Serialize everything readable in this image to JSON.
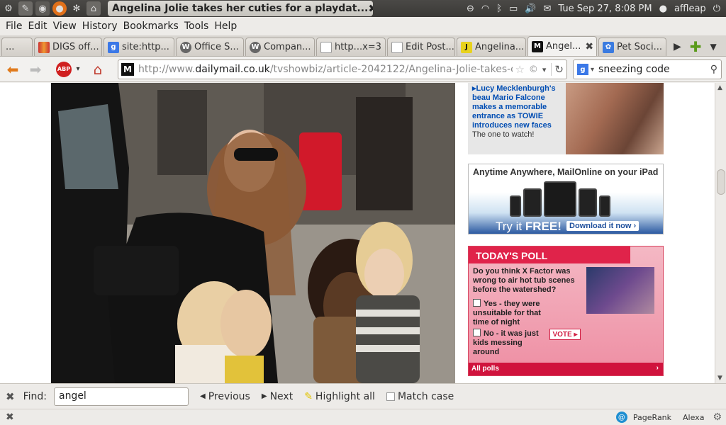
{
  "window": {
    "title": "Angelina Jolie takes her cuties for a playdat..."
  },
  "tray": {
    "datetime": "Tue Sep 27,  8:08 PM",
    "user": "affleap"
  },
  "menu": [
    "File",
    "Edit",
    "View",
    "History",
    "Bookmarks",
    "Tools",
    "Help"
  ],
  "tabs": [
    {
      "label": "...",
      "fav": ""
    },
    {
      "label": "DIGS off...",
      "fav": "digs"
    },
    {
      "label": "site:http...",
      "fav": "google"
    },
    {
      "label": "Office S...",
      "fav": "wp"
    },
    {
      "label": "Compan...",
      "fav": "wp"
    },
    {
      "label": "http...x=3",
      "fav": "doc"
    },
    {
      "label": "Edit Post...",
      "fav": "doc"
    },
    {
      "label": "Angelina...",
      "fav": "j"
    },
    {
      "label": "Angel...",
      "fav": "dm",
      "active": true
    },
    {
      "label": "Pet Soci...",
      "fav": "paw"
    }
  ],
  "nav": {
    "url_prefix": "http://www.",
    "url_domain": "dailymail.co.uk",
    "url_path": "/tvshowbiz/article-2042122/Angelina-Jolie-takes-cutie",
    "search_value": "sneezing code"
  },
  "promo": {
    "headline": "Lucy Mecklenburgh's beau Mario Falcone makes a memorable entrance as TOWIE introduces new faces",
    "sub": "The one to watch!"
  },
  "ipad": {
    "title": "Anytime Anywhere, MailOnline on your iPad",
    "try": "Try it ",
    "free": "FREE!",
    "download": "Download it now"
  },
  "poll": {
    "header": "TODAY'S POLL",
    "question": "Do you think X Factor was wrong to air hot tub scenes before the watershed?",
    "option1": "Yes - they were unsuitable for that time of night",
    "option2": "No - it was just kids messing around",
    "vote": "VOTE",
    "all": "All polls"
  },
  "find": {
    "label": "Find:",
    "value": "angel",
    "previous": "Previous",
    "next": "Next",
    "highlight": "Highlight all",
    "match_case": "Match case"
  },
  "status": {
    "pagerank": "PageRank",
    "alexa": "Alexa"
  }
}
